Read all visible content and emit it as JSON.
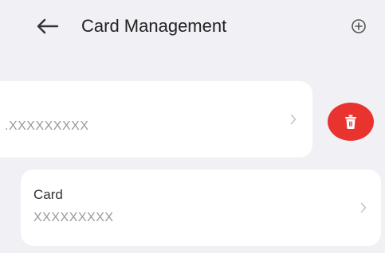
{
  "header": {
    "title": "Card Management",
    "back_icon": "arrow-left-icon",
    "add_icon": "plus-circle-icon"
  },
  "cards": [
    {
      "name": "",
      "number": ".XXXXXXXXX"
    },
    {
      "name": "Card",
      "number": "XXXXXXXXX"
    }
  ],
  "delete_icon": "trash-icon",
  "colors": {
    "background": "#f0f0f5",
    "card": "#ffffff",
    "delete": "#e8332f",
    "title": "#222222",
    "muted": "#9a9a9a"
  }
}
